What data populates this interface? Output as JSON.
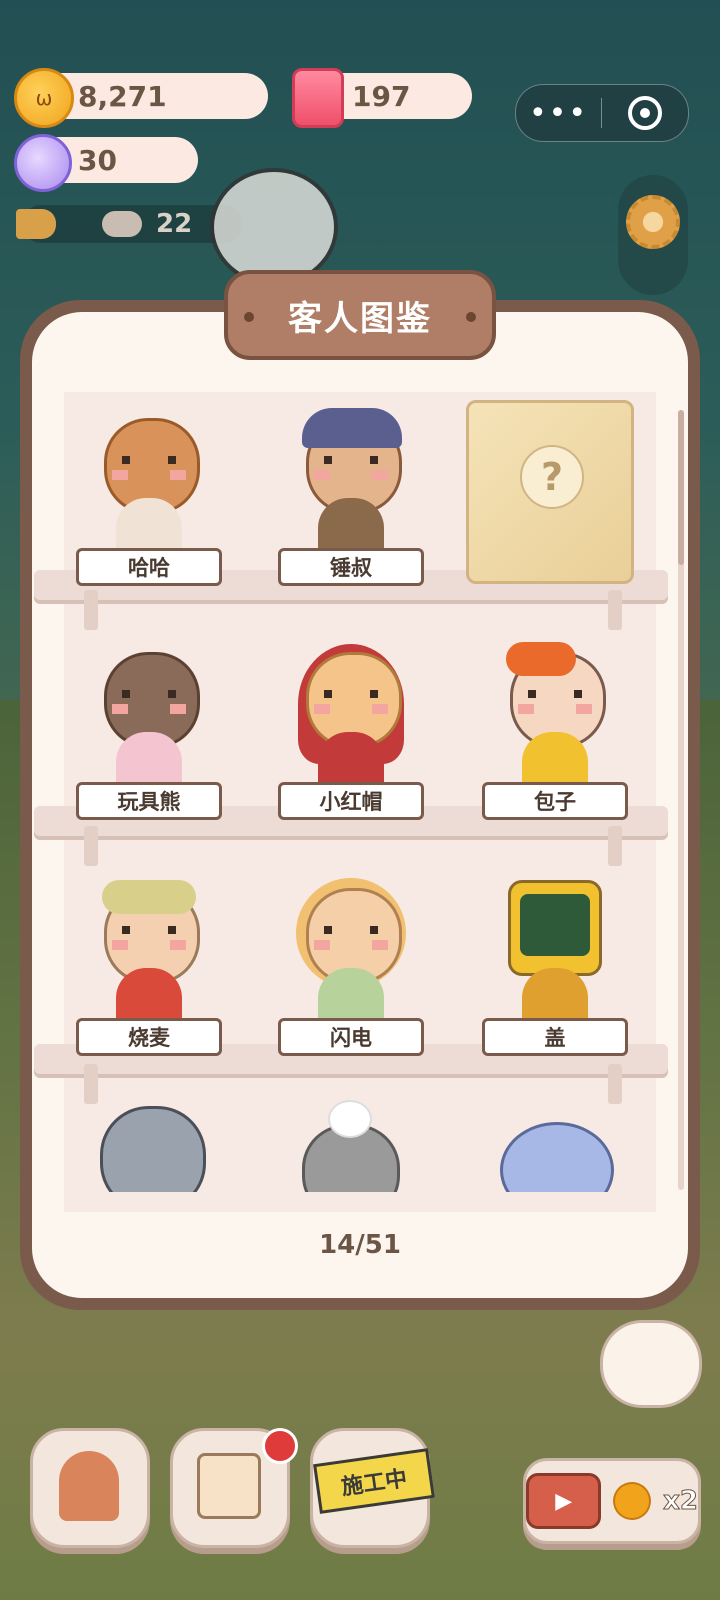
{
  "resources": {
    "coins": "8,271",
    "gems": "197",
    "candy": "30",
    "visitors": "22"
  },
  "miniprogram": {
    "more_icon": "ellipsis-icon",
    "close_icon": "target-icon"
  },
  "dialog": {
    "title": "客人图鉴",
    "progress": "14/51",
    "rows": [
      [
        {
          "name": "哈哈",
          "color": "#d9935a"
        },
        {
          "name": "锤叔",
          "color": "#e4b58c"
        },
        {
          "name": "",
          "locked": true
        }
      ],
      [
        {
          "name": "玩具熊",
          "color": "#8a6a58"
        },
        {
          "name": "小红帽",
          "color": "#f4c48a"
        },
        {
          "name": "包子",
          "color": "#f6d7c2"
        }
      ],
      [
        {
          "name": "烧麦",
          "color": "#f4cfb0"
        },
        {
          "name": "闪电",
          "color": "#f4cfa8"
        },
        {
          "name": "盖",
          "color": "#f1c12f"
        }
      ],
      [
        {
          "name": "",
          "color": "#9aa3ad"
        },
        {
          "name": "",
          "color": "#9a9a9a"
        },
        {
          "name": "",
          "color": "#a8b8e6"
        }
      ]
    ]
  },
  "bottom_bar": {
    "construction_label": "施工中",
    "video_multiplier": "x2"
  },
  "colors": {
    "frame": "#7a5a4a",
    "paper": "#fdf6ef",
    "shelf": "#ecdcd5"
  }
}
